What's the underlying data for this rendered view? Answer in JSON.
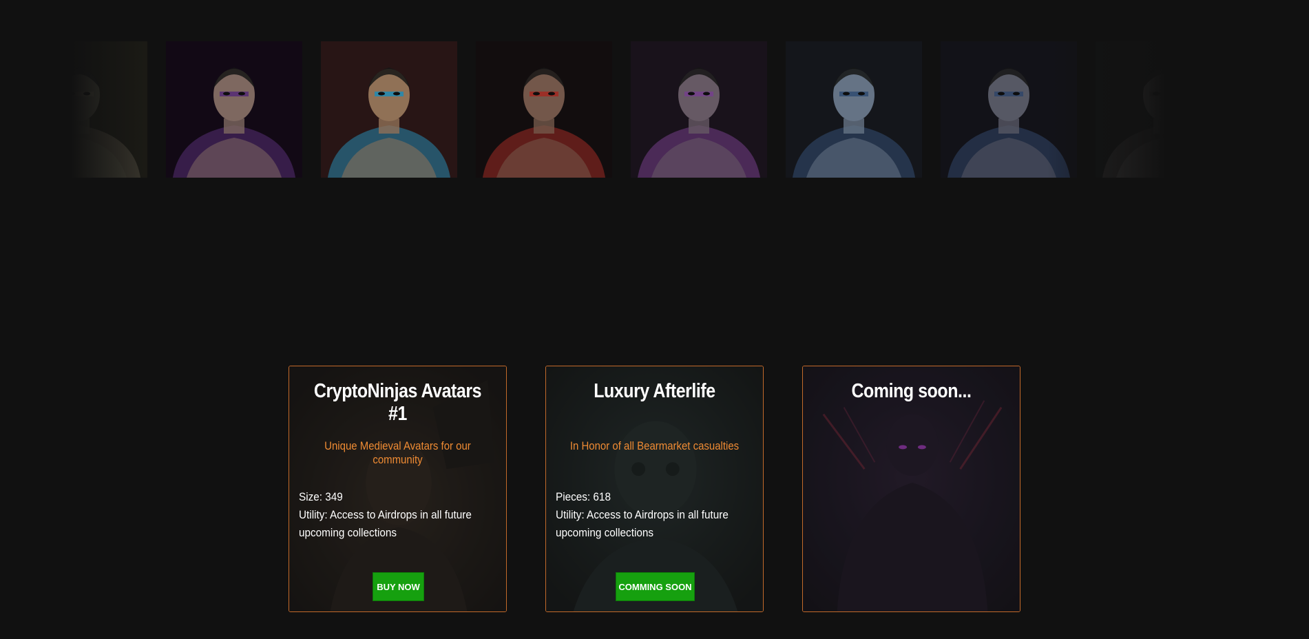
{
  "gallery": {
    "items": [
      {
        "name": "samurai-partial",
        "skin": "#5a5748",
        "accent": "#6f6a57",
        "bg": "#2b2a22"
      },
      {
        "name": "tattooed-warrior-purple",
        "skin": "#9a7f76",
        "accent": "#6a3a8f",
        "bg": "#1c0d1f"
      },
      {
        "name": "blue-masked-woman",
        "skin": "#b08a6a",
        "accent": "#2fa7d6",
        "bg": "#3a1f1f"
      },
      {
        "name": "red-painted-fighter",
        "skin": "#8d6b5b",
        "accent": "#c2352b",
        "bg": "#1c1416"
      },
      {
        "name": "hooded-ninja",
        "skin": "#7d6d7a",
        "accent": "#8e4fa8",
        "bg": "#251b29"
      },
      {
        "name": "bearded-blue-warrior",
        "skin": "#7c8da3",
        "accent": "#3f5f8c",
        "bg": "#1e2228"
      },
      {
        "name": "hooded-assassin",
        "skin": "#6a6c7a",
        "accent": "#3d5680",
        "bg": "#1c1c24"
      },
      {
        "name": "horned-demon",
        "skin": "#5c5a5a",
        "accent": "#4a4545",
        "bg": "#1e1f1f"
      }
    ]
  },
  "cards": [
    {
      "title": "CryptoNinjas Avatars #1",
      "subtitle": "Unique Medieval Avatars for our community",
      "line1": "Size: 349",
      "line2": "Utility: Access to Airdrops in all future",
      "line3": "upcoming collections",
      "button": "BUY NOW"
    },
    {
      "title": "Luxury Afterlife",
      "subtitle": "In Honor of all Bearmarket casualties",
      "line1": "Pieces: 618",
      "line2": "Utility: Access to Airdrops in all future",
      "line3": "upcoming collections",
      "button": "COMMING SOON"
    },
    {
      "title": "Coming soon..."
    }
  ],
  "colors": {
    "page_bg": "#111111",
    "card_border": "#c46a2a",
    "subtitle": "#ef8b33",
    "button_bg": "#16a00f"
  }
}
